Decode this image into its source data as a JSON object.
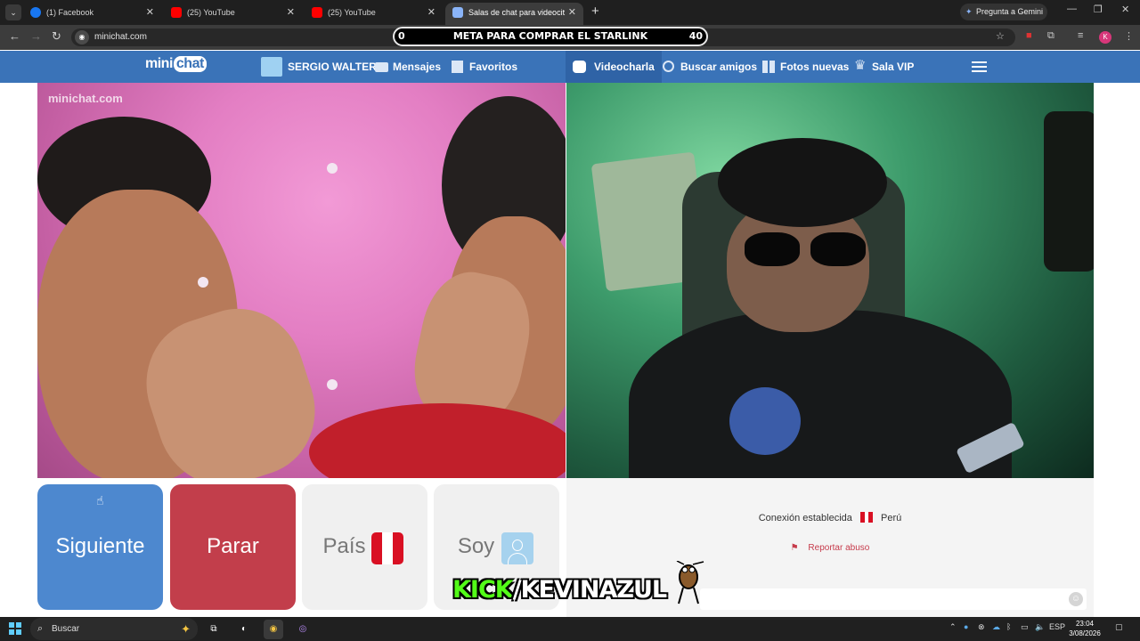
{
  "browser": {
    "tabs": [
      {
        "title": "(1) Facebook",
        "icon": "facebook-icon",
        "color": "#1877f2"
      },
      {
        "title": "(25) YouTube",
        "icon": "youtube-icon",
        "color": "#ff0000"
      },
      {
        "title": "(25) YouTube",
        "icon": "youtube-icon",
        "color": "#ff0000"
      },
      {
        "title": "Salas de chat para videocit",
        "icon": "minichat-icon",
        "color": "#8ab4f8"
      }
    ],
    "gemini_label": "Pregunta a Gemini",
    "url": "minichat.com",
    "overlay_banner": {
      "left": "0",
      "text": "META PARA COMPRAR EL STARLINK",
      "right": "40"
    },
    "profile_initial": "K"
  },
  "site": {
    "logo_mini": "mini",
    "logo_chat": "chat",
    "watermark": "minichat.com",
    "nav": {
      "user": "SERGIO WALTER",
      "messages": "Mensajes",
      "favorites": "Favoritos",
      "videochat": "Videocharla",
      "search_friends": "Buscar amigos",
      "new_photos": "Fotos nuevas",
      "vip_room": "Sala VIP"
    },
    "controls": {
      "next": "Siguiente",
      "stop": "Parar",
      "country": "País",
      "me": "Soy"
    },
    "chat": {
      "connection_status": "Conexión establecida",
      "country": "Perú",
      "report": "Reportar abuso"
    },
    "colors": {
      "nav": "#3a73b8",
      "next": "#4d88cf",
      "stop": "#c23e4b",
      "peru_red": "#d91023"
    }
  },
  "stream_overlay": {
    "kick_prefix": "KICK",
    "kick_suffix": "/KEVINAZUL"
  },
  "taskbar": {
    "search_placeholder": "Buscar",
    "language": "ESP",
    "time": "23:04",
    "date": "3/08/2026"
  }
}
